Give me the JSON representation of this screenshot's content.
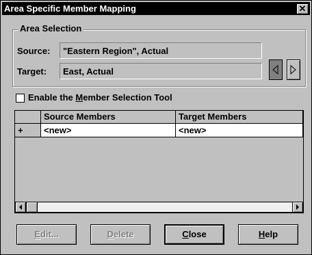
{
  "window": {
    "title": "Area Specific Member Mapping",
    "close_glyph": "✕"
  },
  "area_selection": {
    "legend": "Area Selection",
    "source_label": "Source:",
    "source_value": "\"Eastern Region\", Actual",
    "target_label": "Target:",
    "target_value": "East, Actual"
  },
  "member_tool": {
    "label_pre": "Enable the ",
    "label_key": "M",
    "label_post": "ember Selection Tool",
    "checked": false
  },
  "grid": {
    "columns": [
      "Source Members",
      "Target Members"
    ],
    "rows": [
      {
        "marker": "+",
        "source": "<new>",
        "target": "<new>"
      }
    ]
  },
  "buttons": {
    "edit": {
      "key": "E",
      "rest": "dit..."
    },
    "delete": {
      "key": "D",
      "rest": "elete"
    },
    "close": {
      "key": "C",
      "rest": "lose"
    },
    "help": {
      "key": "H",
      "rest": "elp"
    }
  }
}
